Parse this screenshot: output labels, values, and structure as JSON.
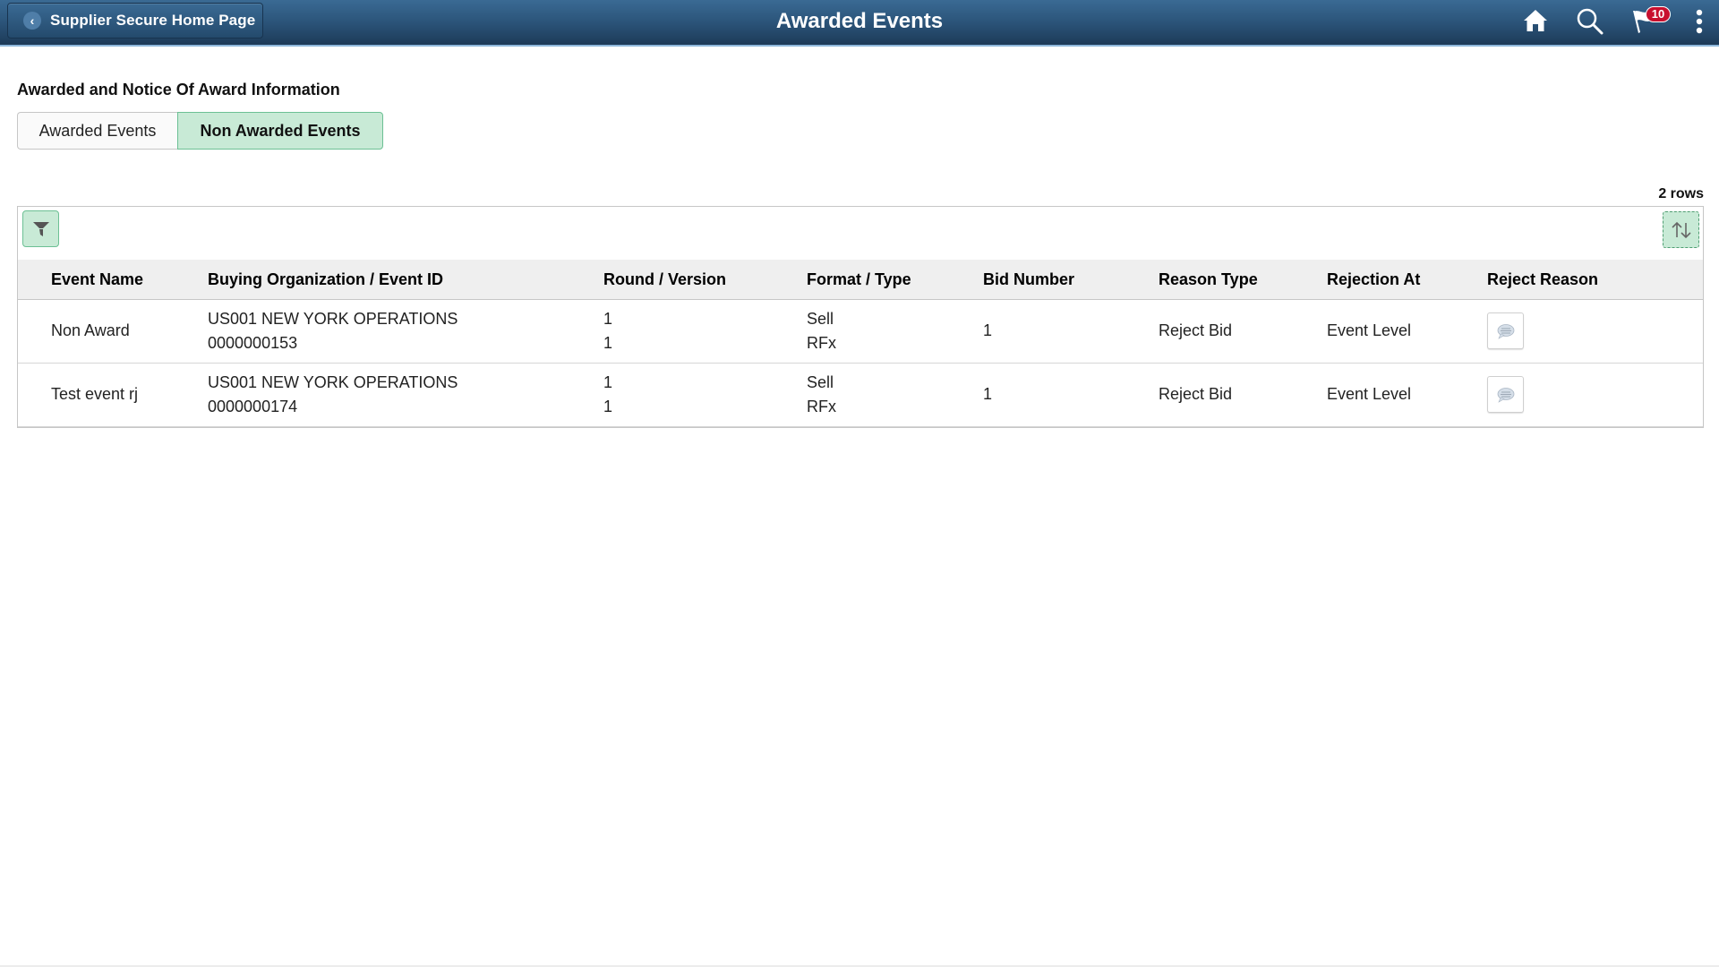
{
  "header": {
    "back_label": "Supplier Secure Home Page",
    "title": "Awarded Events",
    "icons": {
      "home": "home-icon",
      "search": "search-icon",
      "notifications": "flag-icon",
      "actions": "vertical-ellipsis-icon"
    },
    "notification_count": "10",
    "notification_badge_color": "#c8102e"
  },
  "section_title": "Awarded and Notice Of Award Information",
  "tabs": [
    {
      "label": "Awarded Events",
      "selected": false
    },
    {
      "label": "Non Awarded Events",
      "selected": true
    }
  ],
  "grid": {
    "row_count": "2 rows",
    "filter_icon": "filter-icon",
    "sort_icon": "sort-icon",
    "accent_color": "#c8ead6",
    "columns": [
      "Event Name",
      "Buying Organization / Event ID",
      "Round / Version",
      "Format / Type",
      "Bid Number",
      "Reason Type",
      "Rejection At",
      "Reject Reason"
    ],
    "rows": [
      {
        "event_name": "Non Award",
        "buying_org": "US001 NEW YORK OPERATIONS",
        "event_id": "0000000153",
        "round": "1",
        "version": "1",
        "format": "Sell",
        "type": "RFx",
        "bid_number": "1",
        "reason_type": "Reject Bid",
        "rejection_at": "Event Level",
        "reject_reason_icon": "comment-icon"
      },
      {
        "event_name": "Test event rj",
        "buying_org": "US001 NEW YORK OPERATIONS",
        "event_id": "0000000174",
        "round": "1",
        "version": "1",
        "format": "Sell",
        "type": "RFx",
        "bid_number": "1",
        "reason_type": "Reject Bid",
        "rejection_at": "Event Level",
        "reject_reason_icon": "comment-icon"
      }
    ]
  }
}
